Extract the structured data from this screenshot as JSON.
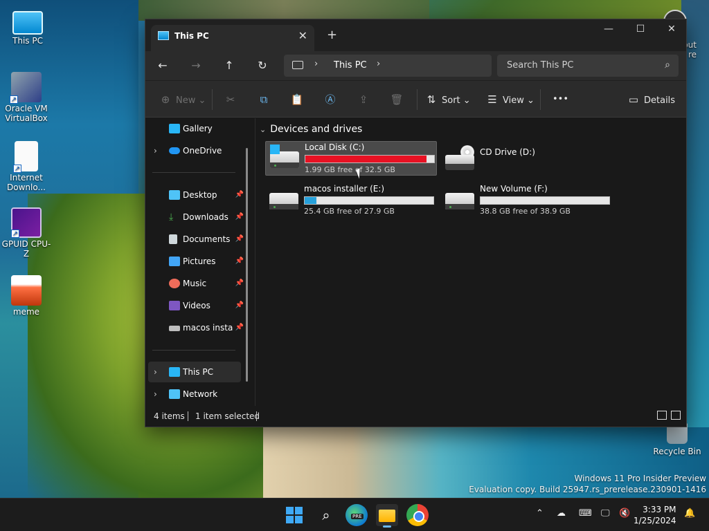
{
  "desktop": {
    "icons": [
      {
        "label": "This PC"
      },
      {
        "label": "Oracle VM VirtualBox"
      },
      {
        "label": "Internet Downlo..."
      },
      {
        "label": "GPUID CPU-Z"
      },
      {
        "label": "meme"
      }
    ],
    "edge_label_1": "out",
    "edge_label_2": "re",
    "recycle_bin": "Recycle Bin",
    "watermark_line1": "Windows 11 Pro Insider Preview",
    "watermark_line2": "Evaluation copy. Build 25947.rs_prerelease.230901-1416"
  },
  "window": {
    "tab_title": "This PC",
    "tab_close": "✕",
    "new_tab": "+",
    "minimize": "—",
    "maximize": "☐",
    "close": "✕",
    "nav": {
      "back": "←",
      "forward": "→",
      "up": "↑",
      "refresh": "↻"
    },
    "breadcrumb": "This PC",
    "search_placeholder": "Search This PC",
    "toolbar": {
      "new": "New",
      "sort": "Sort",
      "view": "View",
      "more": "•••",
      "details": "Details"
    },
    "sidebar": {
      "gallery": "Gallery",
      "onedrive": "OneDrive",
      "desktop": "Desktop",
      "downloads": "Downloads",
      "documents": "Documents",
      "pictures": "Pictures",
      "music": "Music",
      "videos": "Videos",
      "macos": "macos installer",
      "this_pc": "This PC",
      "network": "Network"
    },
    "group_title": "Devices and drives",
    "drives": [
      {
        "name": "Local Disk (C:)",
        "free": "1.99 GB free of 32.5 GB",
        "used_fraction": 0.94,
        "bar_color": "#e81123"
      },
      {
        "name": "CD Drive (D:)"
      },
      {
        "name": "macos installer (E:)",
        "free": "25.4 GB free of 27.9 GB",
        "used_fraction": 0.09,
        "bar_color": "#26a0da"
      },
      {
        "name": "New Volume (F:)",
        "free": "38.8 GB free of 38.9 GB",
        "used_fraction": 0.0,
        "bar_color": "#26a0da"
      }
    ],
    "status": {
      "items": "4 items",
      "selected": "1 item selected"
    }
  },
  "taskbar": {
    "time": "3:33 PM",
    "date": "1/25/2024",
    "edge_badge": "PRE"
  }
}
